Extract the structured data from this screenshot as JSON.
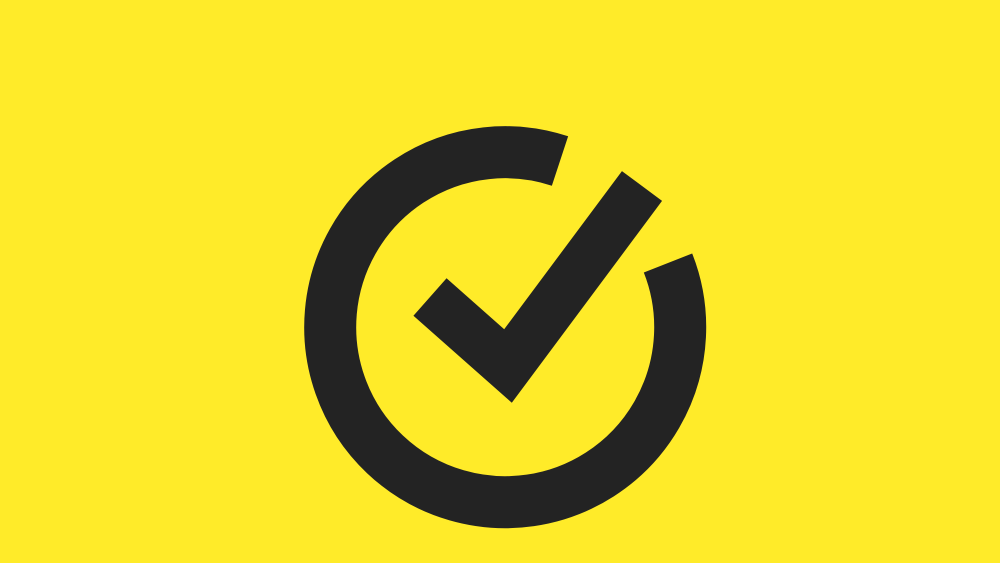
{
  "colors": {
    "background": "#FFEB29",
    "mark": "#232323"
  },
  "logo": {
    "icon": "check-circle-icon"
  }
}
